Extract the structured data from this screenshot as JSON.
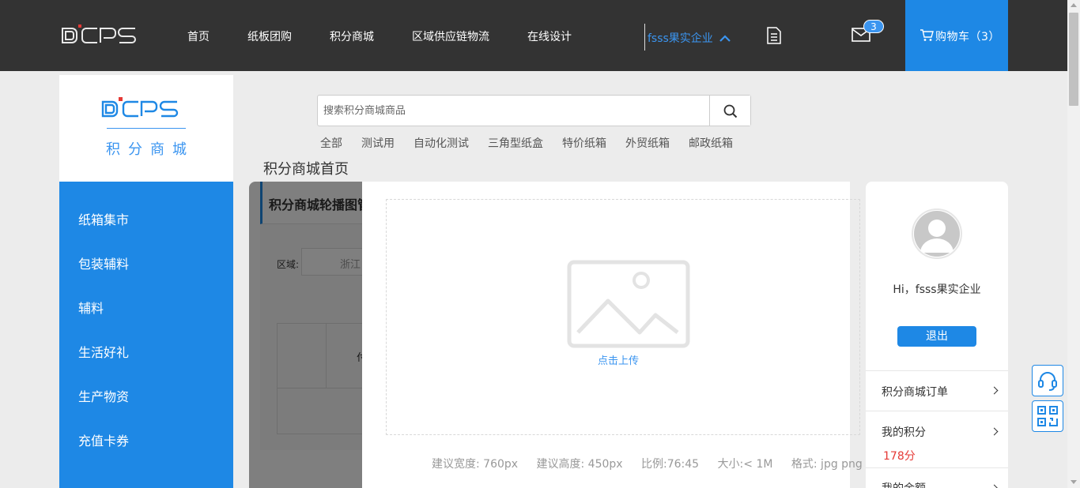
{
  "header": {
    "logo_alt": "DCPS",
    "nav": [
      "首页",
      "纸板团购",
      "积分商城",
      "区域供应链物流",
      "在线设计"
    ],
    "user_name": "fsss果实企业",
    "mail_count": "3",
    "cart_label": "购物车（3）",
    "icons": {
      "doc": "document-icon",
      "mail": "mail-icon",
      "cart": "cart-icon",
      "caret": "chevron-up-icon"
    },
    "accent_color": "#1e88e5"
  },
  "brand": {
    "logo_text": "DCPS",
    "subtitle": "积分商城"
  },
  "sidebar": {
    "items": [
      "纸箱集市",
      "包装辅料",
      "辅料",
      "生活好礼",
      "生产物资",
      "充值卡券"
    ]
  },
  "search": {
    "placeholder": "搜索积分商城商品",
    "tags": [
      "全部",
      "测试用",
      "自动化测试",
      "三角型纸盒",
      "特价纸箱",
      "外贸纸箱",
      "邮政纸箱"
    ]
  },
  "page": {
    "title": "积分商城首页"
  },
  "background_panel": {
    "heading": "积分商城轮播图管",
    "region_label": "区域:",
    "region_value": "浙江",
    "table_cell": "付"
  },
  "upload": {
    "action_text": "点击上传",
    "hints": [
      "建议宽度: 760px",
      "建议高度: 450px",
      "比例:76:45",
      "大小:< 1M",
      "格式: jpg png"
    ]
  },
  "user_card": {
    "greeting": "Hi，fsss果实企业",
    "logout_label": "退出",
    "rows": [
      {
        "label": "积分商城订单"
      },
      {
        "label": "我的积分",
        "value": "178分"
      },
      {
        "label": "我的余额"
      }
    ]
  },
  "floating": {
    "service_icon": "headset-icon",
    "qr_icon": "qrcode-icon"
  }
}
